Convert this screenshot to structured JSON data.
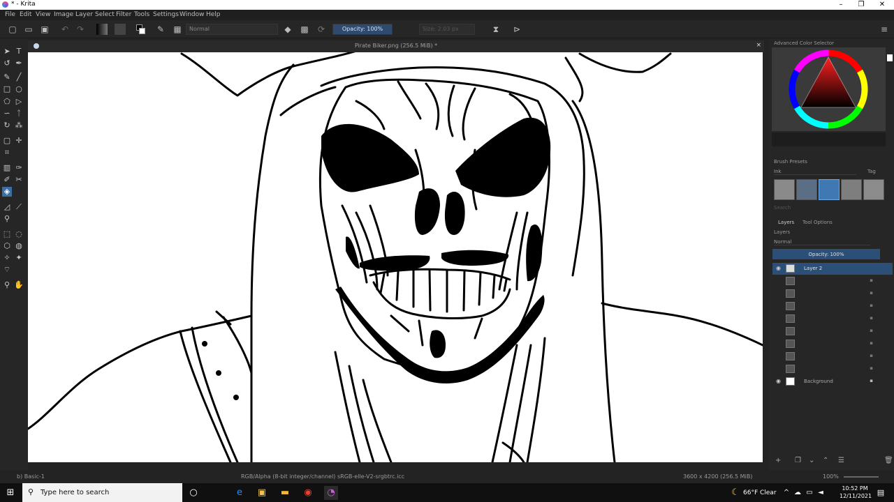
{
  "window": {
    "title": "* - Krita",
    "minimize": "–",
    "maximize": "❐",
    "close": "✕"
  },
  "menu": [
    "File",
    "Edit",
    "View",
    "Image",
    "Layer",
    "Select",
    "Filter",
    "Tools",
    "Settings",
    "Window",
    "Help"
  ],
  "toolbar": {
    "blend_mode": "Normal",
    "opacity": "Opacity: 100%",
    "size": "Size: 2.03 px"
  },
  "canvas": {
    "title": "Pirate Biker.png (256.5 MiB) *",
    "close": "×"
  },
  "docker": {
    "color_selector_title": "Advanced Color Selector",
    "brush_presets_title": "Brush Presets",
    "brush_tag": "Ink",
    "brush_tag_label": "Tag",
    "search_placeholder": "Search",
    "tab_layers": "Layers",
    "tab_tool_options": "Tool Options",
    "layers_title": "Layers",
    "layers_blend": "Normal",
    "layers_opacity": "Opacity: 100%",
    "layers": [
      {
        "name": "Layer 2",
        "visible": true,
        "selected": true
      },
      {
        "name": "",
        "visible": false
      },
      {
        "name": "",
        "visible": false
      },
      {
        "name": "",
        "visible": false
      },
      {
        "name": "",
        "visible": false
      },
      {
        "name": "",
        "visible": false
      },
      {
        "name": "",
        "visible": false
      },
      {
        "name": "",
        "visible": false
      },
      {
        "name": "",
        "visible": false
      },
      {
        "name": "Background",
        "visible": true
      }
    ]
  },
  "status": {
    "brush": "b) Basic-1",
    "color_info": "RGB/Alpha (8-bit integer/channel)  sRGB-elle-V2-srgbtrc.icc",
    "dimensions": "3600 x 4200 (256.5 MiB)",
    "zoom": "100%"
  },
  "taskbar": {
    "search_placeholder": "Type here to search",
    "weather": "66°F  Clear",
    "time": "10:52 PM",
    "date": "12/11/2021"
  },
  "colors": {
    "accent": "#3a6ea5",
    "selected_row": "#2c4f78",
    "canvas": "#ffffff"
  }
}
